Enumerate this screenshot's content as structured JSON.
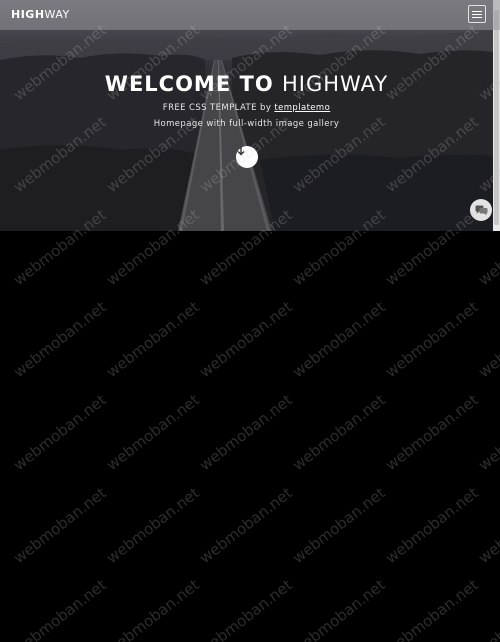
{
  "navbar": {
    "brand_strong": "HIGH",
    "brand_light": "WAY",
    "menu_icon": "hamburger-menu-icon"
  },
  "hero": {
    "title_bold": "WELCOME TO",
    "title_light": "HIGHWAY",
    "subtitle_prefix": "FREE CSS TEMPLATE by",
    "subtitle_link": "templatemo",
    "subtitle_line2": "Homepage with full-width image gallery",
    "scroll_icon": "arrow-down-icon"
  },
  "widgets": {
    "chat_icon": "chat-bubbles-icon"
  },
  "watermark": {
    "text": "webmoban.net"
  }
}
